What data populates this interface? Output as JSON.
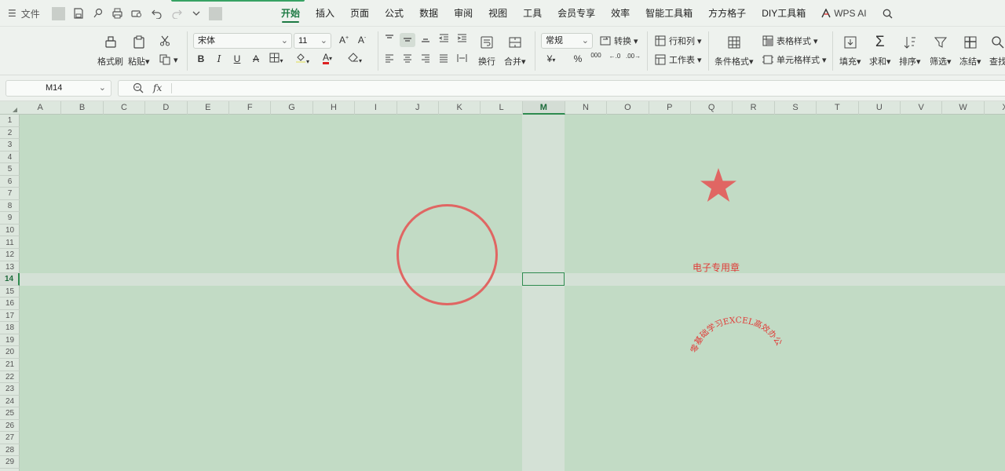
{
  "menu": {
    "file_label": "文件",
    "tabs": [
      "开始",
      "插入",
      "页面",
      "公式",
      "数据",
      "审阅",
      "视图",
      "工具",
      "会员专享",
      "效率",
      "智能工具箱",
      "方方格子",
      "DIY工具箱"
    ],
    "active_tab": "开始",
    "wps_ai_label": "WPS AI"
  },
  "ribbon": {
    "format_painter": "格式刷",
    "paste": "粘贴",
    "font_name": "宋体",
    "font_size": "11",
    "number_format": "常规",
    "convert": "转换",
    "rows_cols": "行和列",
    "worksheet": "工作表",
    "conditional_format": "条件格式",
    "table_style": "表格样式",
    "cell_style": "单元格样式",
    "wrap": "换行",
    "merge": "合并",
    "fill": "填充",
    "sum": "求和",
    "sort": "排序",
    "filter": "筛选",
    "freeze": "冻结",
    "find": "查找",
    "bold": "B",
    "italic": "I",
    "underline": "U",
    "strike": "A",
    "currency": "¥",
    "percent": "%",
    "thousands": "000"
  },
  "formula_bar": {
    "name_box": "M14",
    "fx": "fx",
    "value": ""
  },
  "sheet": {
    "columns": [
      "A",
      "B",
      "C",
      "D",
      "E",
      "F",
      "G",
      "H",
      "I",
      "J",
      "K",
      "L",
      "M",
      "N",
      "O",
      "P",
      "Q",
      "R",
      "S",
      "T",
      "U",
      "V",
      "W",
      "X"
    ],
    "rows": [
      "1",
      "2",
      "3",
      "4",
      "5",
      "6",
      "7",
      "8",
      "9",
      "10",
      "11",
      "12",
      "13",
      "14",
      "15",
      "16",
      "17",
      "18",
      "19",
      "20",
      "21",
      "22",
      "23",
      "24",
      "25",
      "26",
      "27",
      "28",
      "29"
    ],
    "selected_column": "M",
    "selected_row": "14"
  },
  "stamp": {
    "title_text": "电子专用章",
    "arc_text": "零基础学习EXCEL高效办公",
    "color": "#e03b37"
  }
}
